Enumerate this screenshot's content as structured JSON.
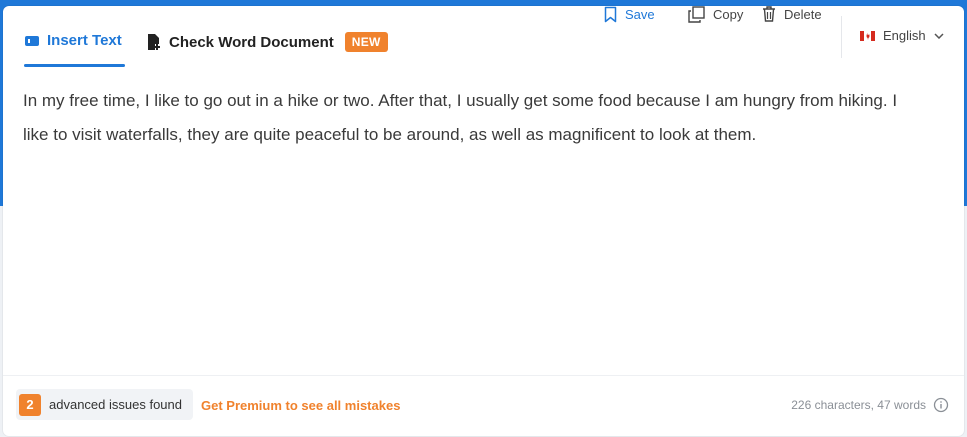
{
  "tabs": {
    "insert_text": {
      "label": "Insert Text",
      "icon": "text-box-icon"
    },
    "check_document": {
      "label": "Check Word Document",
      "icon": "document-plus-icon",
      "badge": "NEW"
    }
  },
  "actions": {
    "save": "Save",
    "copy": "Copy",
    "delete": "Delete"
  },
  "language": {
    "label": "English",
    "flag": "canada-flag-icon"
  },
  "editor": {
    "text": "In my free time, I like to go out in a hike or two. After that, I usually get some food because I am hungry from hiking. I like to visit waterfalls, they are quite peaceful to be around, as well as magnificent to look at them."
  },
  "footer": {
    "issues_count": "2",
    "issues_label": "advanced issues found",
    "premium_link": "Get Premium to see all mistakes",
    "stats": "226 characters, 47 words"
  },
  "colors": {
    "accent": "#1f78d8",
    "premium": "#f0822d",
    "badge": "#f0822d"
  }
}
